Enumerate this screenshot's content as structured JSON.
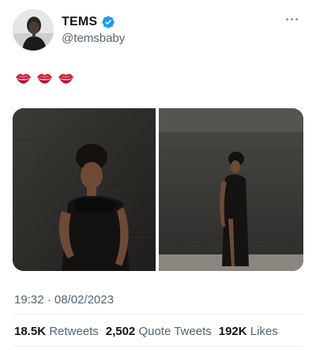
{
  "author": {
    "display_name": "TEMS",
    "handle": "@temsbaby",
    "verified": true,
    "avatar_icon": "profile-photo"
  },
  "tweet": {
    "text": "💋💋💋",
    "emoji_icons": [
      "kiss-mark-icon",
      "kiss-mark-icon",
      "kiss-mark-icon"
    ],
    "media": [
      {
        "description_icon": "photo-portrait-black-dress"
      },
      {
        "description_icon": "photo-full-length-black-dress"
      }
    ],
    "timestamp": "19:32 · 08/02/2023"
  },
  "stats": {
    "retweets_count": "18.5K",
    "retweets_label": "Retweets",
    "quote_tweets_count": "2,502",
    "quote_tweets_label": "Quote Tweets",
    "likes_count": "192K",
    "likes_label": "Likes"
  },
  "colors": {
    "verified_blue": "#1d9bf0",
    "secondary_text": "#536471",
    "primary_text": "#0f1419",
    "lip_red": "#cc1e3a"
  }
}
